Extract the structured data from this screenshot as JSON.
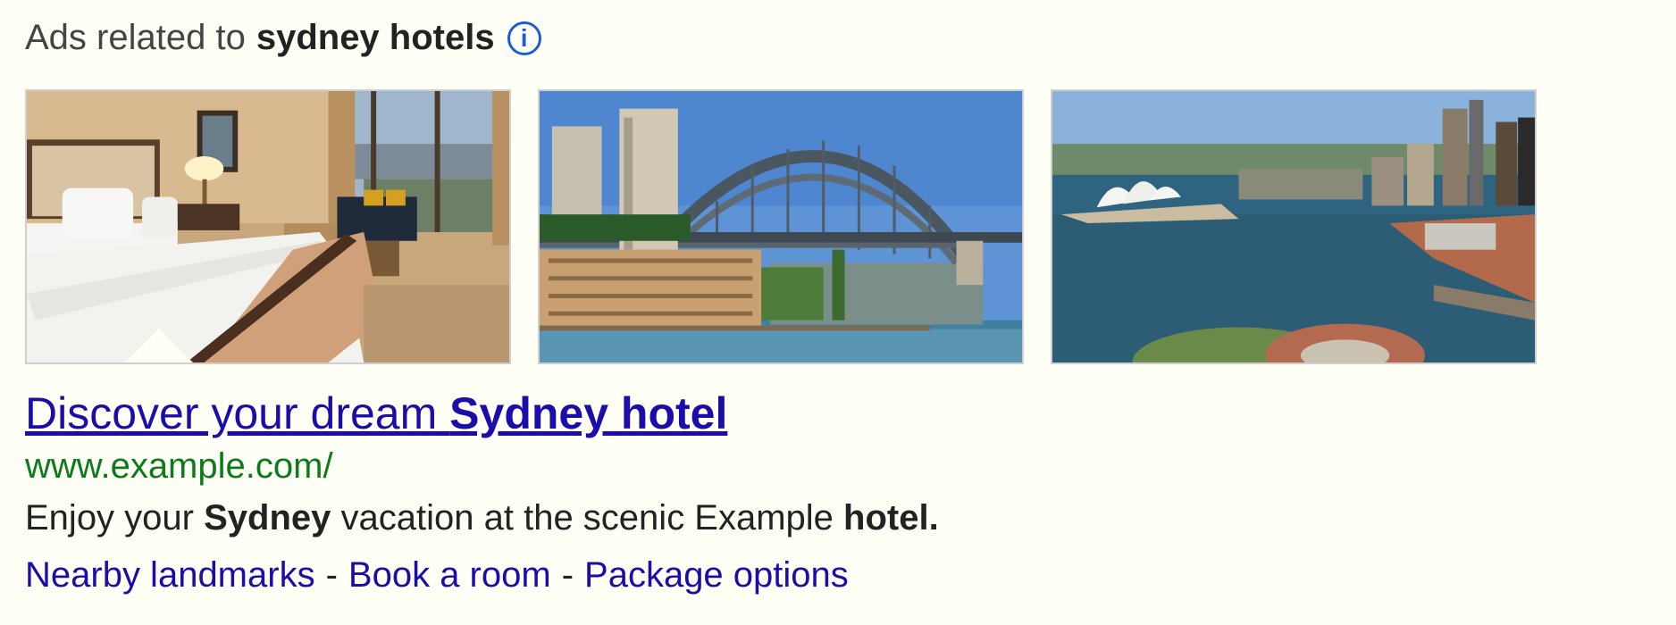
{
  "header": {
    "prefix": "Ads related to",
    "query": "sydney hotels",
    "info_icon": "info-icon",
    "info_glyph": "i"
  },
  "images": [
    {
      "name": "hotel-room"
    },
    {
      "name": "harbour-bridge"
    },
    {
      "name": "opera-house-harbour"
    }
  ],
  "ad": {
    "title_plain": "Discover your dream ",
    "title_bold": "Sydney hotel",
    "url": "www.example.com/",
    "desc_1": "Enjoy your ",
    "desc_bold_1": "Sydney",
    "desc_2": " vacation at the scenic Example ",
    "desc_bold_2": "hotel."
  },
  "sitelinks": [
    {
      "label": "Nearby landmarks"
    },
    {
      "label": "Book a room"
    },
    {
      "label": "Package options"
    }
  ],
  "separator": "-",
  "colors": {
    "background": "#fffff6",
    "link_blue": "#1a0dab",
    "url_green": "#0c7b1c",
    "info_blue": "#1a5bd8"
  }
}
